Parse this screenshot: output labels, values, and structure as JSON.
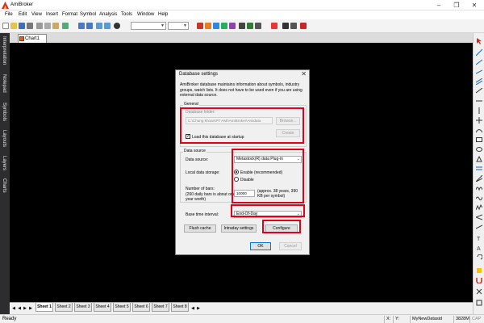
{
  "app": {
    "title": "AmiBroker"
  },
  "menu": [
    "File",
    "Edit",
    "View",
    "Insert",
    "Format",
    "Symbol",
    "Analysis",
    "Tools",
    "Window",
    "Help"
  ],
  "doc_tab": {
    "label": "Chart1"
  },
  "left_panel_tabs": [
    "Interpretation",
    "Notepad",
    "Symbols",
    "Layouts",
    "Layers",
    "Charts"
  ],
  "dialog": {
    "title": "Database settings",
    "description": "AmiBroker database maintains information about symbols, industry groups, watch lists. It does not have to be used even if you are using external data source.",
    "general": {
      "group_label": "General",
      "folder_label": "Database folder:",
      "folder_value": "C:\\Chung khoan\\PT AMI\\AmiBroker\\Amidata",
      "browse_label": "Browse...",
      "create_label": "Create",
      "load_at_startup_label": "Load this database at startup",
      "load_at_startup_checked": true
    },
    "data_source": {
      "group_label": "Data source",
      "source_label": "Data source:",
      "source_value": "Metastock(R) data Plug-in",
      "storage_label": "Local data storage:",
      "enable_label": "Enable (recommended)",
      "disable_label": "Disable",
      "bars_label": "Number of bars:",
      "bars_sublabel": "(260 daily bars is about one year worth)",
      "bars_value": "10000",
      "bars_note": "(approx. 38 years, 390 KB per symbol)"
    },
    "base_time_label": "Base time interval:",
    "base_time_value": "End-Of-Day",
    "flush_label": "Flush cache",
    "intraday_label": "Intraday settings",
    "configure_label": "Configure",
    "ok_label": "OK",
    "cancel_label": "Cancel"
  },
  "sheets": [
    "Sheet 1",
    "Sheet 2",
    "Sheet 3",
    "Sheet 4",
    "Sheet 5",
    "Sheet 6",
    "Sheet 7",
    "Sheet 8"
  ],
  "status": {
    "ready": "Ready",
    "x": "X:",
    "y": "Y:",
    "db": "MyNewDatasid",
    "mem": "3828M",
    "cap": "CAP"
  },
  "colors": {
    "highlight": "#e3001b",
    "chart_bg": "#000000",
    "panel_bg": "#2d2d30"
  }
}
